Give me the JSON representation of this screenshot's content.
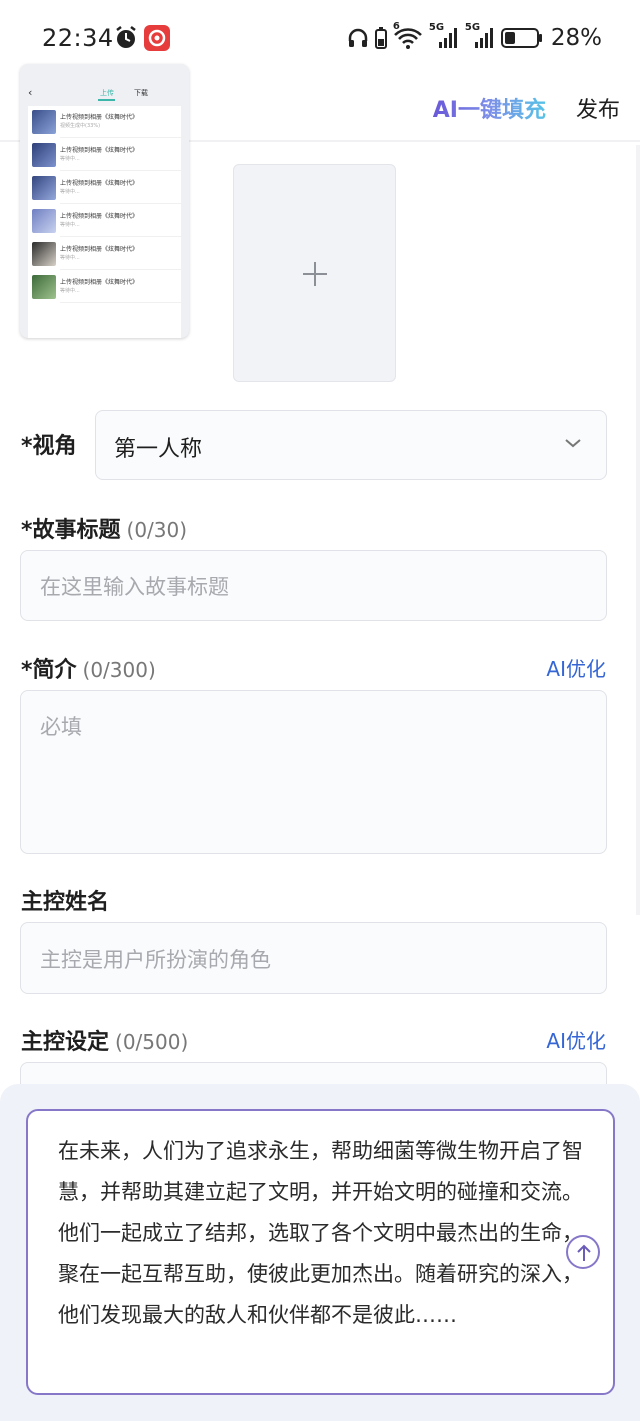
{
  "status_bar": {
    "time": "22:34",
    "network_1": "5G",
    "network_2": "5G",
    "wifi_label": "6",
    "battery": "28%",
    "icons": [
      "alarm-icon",
      "netease-music-icon",
      "headphones-icon",
      "battery-small-icon",
      "wifi-icon",
      "signal-icon",
      "battery-icon"
    ]
  },
  "header": {
    "ai_fill_label": "AI一键填充",
    "publish_label": "发布"
  },
  "thumbnail": {
    "tab_upload": "上传",
    "tab_download": "下载",
    "rows": [
      {
        "title": "上传视频到相册《炫舞时代》",
        "sub": "视频生成中(33%)"
      },
      {
        "title": "上传视频到相册《炫舞时代》",
        "sub": "等待中..."
      },
      {
        "title": "上传视频到相册《炫舞时代》",
        "sub": "等待中..."
      },
      {
        "title": "上传视频到相册《炫舞时代》",
        "sub": "等待中..."
      },
      {
        "title": "上传视频到相册《炫舞时代》",
        "sub": "等待中..."
      },
      {
        "title": "上传视频到相册《炫舞时代》",
        "sub": "等待中..."
      }
    ]
  },
  "form": {
    "perspective": {
      "label": "*视角",
      "value": "第一人称"
    },
    "story_title": {
      "label": "*故事标题",
      "count": "(0/30)",
      "placeholder": "在这里输入故事标题"
    },
    "intro": {
      "label": "*简介",
      "count": "(0/300)",
      "ai_label": "AI优化",
      "placeholder": "必填"
    },
    "protagonist_name": {
      "label": "主控姓名",
      "placeholder": "主控是用户所扮演的角色"
    },
    "protagonist_setting": {
      "label": "主控设定",
      "count": "(0/500)",
      "ai_label": "AI优化"
    }
  },
  "story_prompt": {
    "text": "在未来，人们为了追求永生，帮助细菌等微生物开启了智慧，并帮助其建立起了文明，并开始文明的碰撞和交流。他们一起成立了结邦，选取了各个文明中最杰出的生命，聚在一起互帮互助，使彼此更加杰出。随着研究的深入，他们发现最大的敌人和伙伴都不是彼此……"
  },
  "colors": {
    "accent_blue": "#3666d4",
    "accent_purple": "#8677c9",
    "placeholder_gray": "#a7a9ae"
  }
}
